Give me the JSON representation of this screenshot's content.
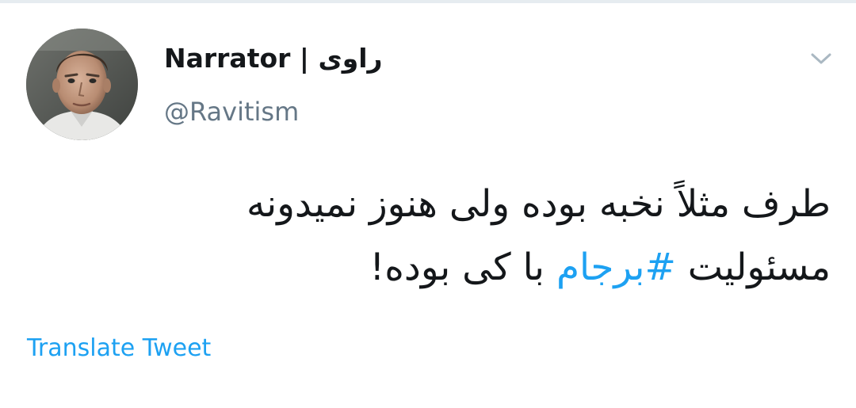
{
  "tweet": {
    "author": {
      "display_name": "Narrator | راوی",
      "handle": "@Ravitism"
    },
    "text": {
      "line1": "طرف مثلاً نخبه بوده ولی هنوز نمیدونه",
      "line2_before": "مسئولیت ",
      "hashtag": "#برجام",
      "line2_after": " با کی بوده!"
    },
    "translate_label": "Translate Tweet"
  },
  "icons": {
    "avatar": "avatar-photo",
    "caret": "chevron-down-icon"
  },
  "colors": {
    "text": "#14171a",
    "secondary": "#657786",
    "link": "#1da1f2",
    "caret": "#aab8c2"
  }
}
